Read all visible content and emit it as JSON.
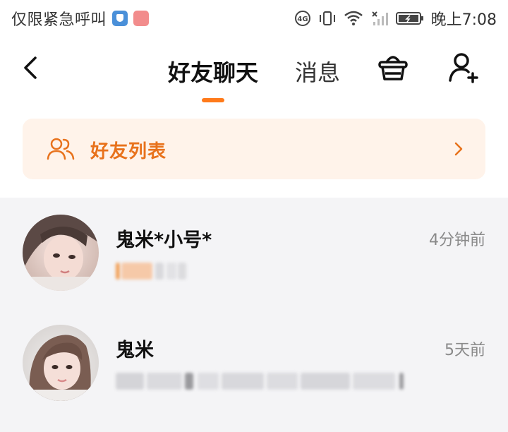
{
  "status_bar": {
    "carrier_text": "仅限紧急呼叫",
    "time": "晚上7:08"
  },
  "nav": {
    "tabs": [
      {
        "label": "好友聊天",
        "active": true
      },
      {
        "label": "消息",
        "active": false
      }
    ],
    "icons": [
      "back-arrow-icon",
      "basket-icon",
      "add-user-icon"
    ]
  },
  "friend_list_banner": {
    "label": "好友列表"
  },
  "conversations": [
    {
      "name": "鬼米*小号*",
      "time": "4分钟前",
      "preview_blurred": true
    },
    {
      "name": "鬼米",
      "time": "5天前",
      "preview_blurred": true
    }
  ],
  "colors": {
    "accent": "#ff7a1a",
    "banner_bg": "#fff3ea",
    "banner_text": "#e8721c",
    "list_bg": "#f4f4f6",
    "muted_text": "#8a8a8a"
  }
}
